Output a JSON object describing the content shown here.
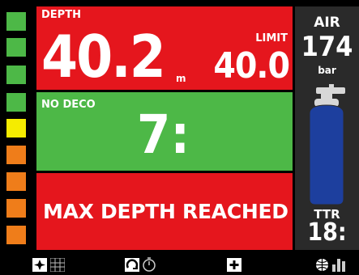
{
  "depth": {
    "label": "DEPTH",
    "value": "40.2",
    "unit": "m",
    "limit_label": "LIMIT",
    "limit_value": "40.0"
  },
  "nodeco": {
    "label": "NO DECO",
    "value": "7:"
  },
  "alert": {
    "message": "MAX DEPTH REACHED"
  },
  "air": {
    "label": "AIR",
    "value": "174",
    "unit": "bar",
    "tank_level": 0.9,
    "ttr_label": "TTR",
    "ttr_value": "18:"
  },
  "ascent_gauge": {
    "segments": [
      "green",
      "green",
      "green",
      "green",
      "yellow",
      "orange",
      "orange",
      "orange",
      "orange",
      "orange"
    ]
  },
  "colors": {
    "alarm_red": "#e5161d",
    "ok_green": "#4db847",
    "tank_blue": "#1d3f9e",
    "gauge_yellow": "#f5ec00",
    "gauge_orange": "#ef7d1a"
  },
  "toolbar": {
    "icons": [
      "compass-icon",
      "table-icon",
      "refresh-icon",
      "timer-icon",
      "plus-icon",
      "globe-icon",
      "bar-chart-icon"
    ]
  }
}
